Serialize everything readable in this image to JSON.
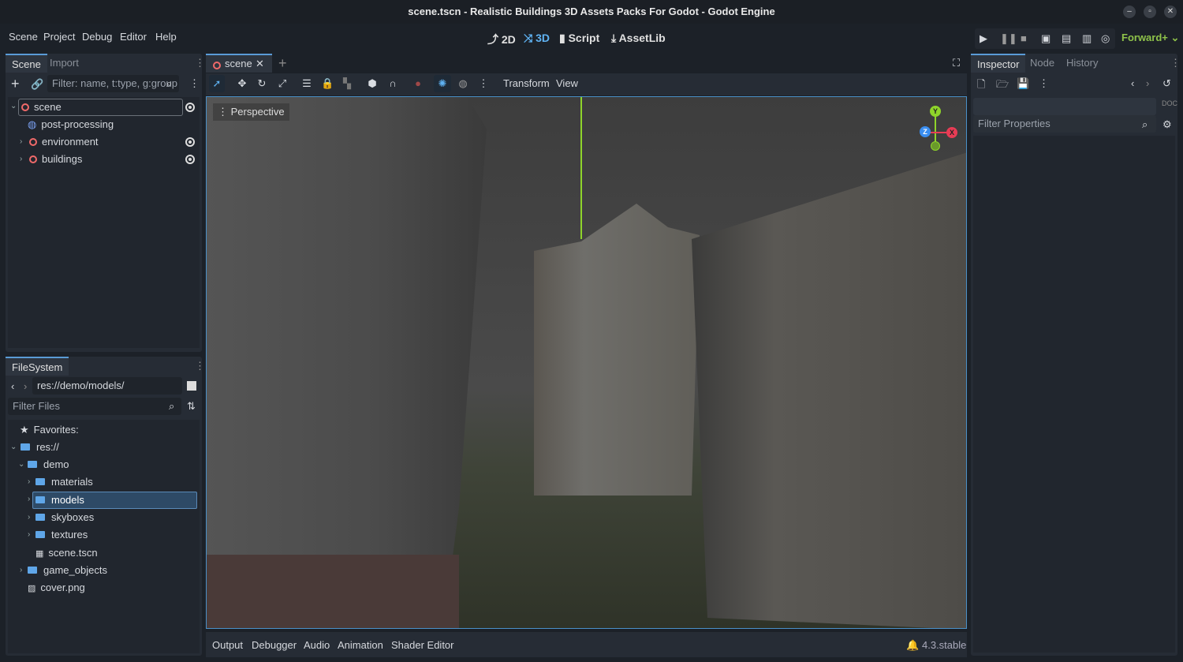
{
  "title": "scene.tscn - Realistic Buildings 3D Assets Packs For Godot - Godot Engine",
  "menu": [
    "Scene",
    "Project",
    "Debug",
    "Editor",
    "Help"
  ],
  "workspaces": [
    "2D",
    "3D",
    "Script",
    "AssetLib"
  ],
  "renderer": "Forward+",
  "scene_dock": {
    "tabs": [
      "Scene",
      "Import"
    ],
    "filter_placeholder": "Filter: name, t:type, g:group",
    "nodes": [
      {
        "label": "scene"
      },
      {
        "label": "post-processing"
      },
      {
        "label": "environment"
      },
      {
        "label": "buildings"
      }
    ]
  },
  "filesystem": {
    "tab": "FileSystem",
    "path": "res://demo/models/",
    "filter_placeholder": "Filter Files",
    "items": [
      "Favorites:",
      "res://",
      "demo",
      "materials",
      "models",
      "skyboxes",
      "textures",
      "scene.tscn",
      "game_objects",
      "cover.png"
    ]
  },
  "editor": {
    "tab": "scene",
    "toolbar_menus": [
      "Transform",
      "View"
    ],
    "viewport_label": "Perspective",
    "gizmo": {
      "x": "X",
      "y": "Y",
      "z": "Z"
    }
  },
  "bottom": {
    "tabs": [
      "Output",
      "Debugger",
      "Audio",
      "Animation",
      "Shader Editor"
    ],
    "version": "4.3.stable"
  },
  "inspector": {
    "tabs": [
      "Inspector",
      "Node",
      "History"
    ],
    "filter_placeholder": "Filter Properties"
  }
}
